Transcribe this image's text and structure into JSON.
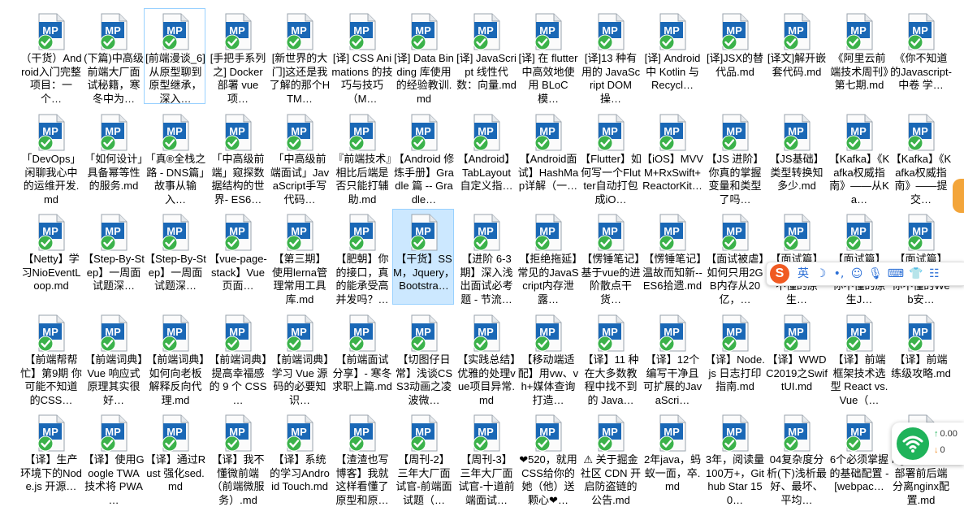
{
  "window": {
    "title": "Markdown files folder view"
  },
  "colors": {
    "icon_blue": "#1a68b6",
    "icon_check": "#3bb24a",
    "selection_fill": "#cce8ff",
    "selection_border": "#99d1ff",
    "ime_orange": "#f05a22",
    "wifi_green": "#1fb35a"
  },
  "file_icon": "markdown-mp-file-icon",
  "files": [
    {
      "name": "（干货）Android入门完整项目：一个…",
      "state": ""
    },
    {
      "name": "(下篇)中高级前端大厂面试秘籍，寒冬中为…",
      "state": ""
    },
    {
      "name": "[前端漫谈_6] 从原型聊到原型继承，深入…",
      "state": "outline"
    },
    {
      "name": "[手把手系列之] Docker 部署 vue 项…",
      "state": ""
    },
    {
      "name": "[新世界的大门]这还是我了解的那个HTM…",
      "state": ""
    },
    {
      "name": "[译] CSS Animations 的技巧与技巧（M…",
      "state": ""
    },
    {
      "name": "[译] Data Binding 库使用的经验教训.md",
      "state": ""
    },
    {
      "name": "[译] JavaScript 线性代数：向量.md",
      "state": ""
    },
    {
      "name": "[译] 在 flutter 中高效地使用 BLoC 模…",
      "state": ""
    },
    {
      "name": "[译]13 种有用的 JavaScript DOM 操…",
      "state": ""
    },
    {
      "name": "[译] Android 中 Kotlin 与 Recycl…",
      "state": ""
    },
    {
      "name": "[译]JSX的替代品.md",
      "state": ""
    },
    {
      "name": "[译文]解开嵌套代码.md",
      "state": ""
    },
    {
      "name": "《阿里云前端技术周刊》第七期.md",
      "state": ""
    },
    {
      "name": "《你不知道的Javascript-中卷 学…",
      "state": ""
    },
    {
      "name": "「DevOps」闲聊我心中的运维开发.md",
      "state": ""
    },
    {
      "name": "「如何设计」具备幂等性的服务.md",
      "state": ""
    },
    {
      "name": "「真®全栈之路 - DNS篇」故事从输入…",
      "state": ""
    },
    {
      "name": "「中高级前端」窥探数据结构的世界- ES6…",
      "state": ""
    },
    {
      "name": "「中高级前端面试」JavaScript手写代码…",
      "state": ""
    },
    {
      "name": "『前端技术』相比后端是否只能打辅助.md",
      "state": ""
    },
    {
      "name": "【Android 修炼手册】Gradle 篇 -- Gradle…",
      "state": ""
    },
    {
      "name": "【Android】TabLayout 自定义指…",
      "state": ""
    },
    {
      "name": "【Android面试】HashMap详解（一…",
      "state": ""
    },
    {
      "name": "【Flutter】如何写一个Flutter自动打包成iO…",
      "state": ""
    },
    {
      "name": "【iOS】MVVM+RxSwift+ReactorKit…",
      "state": ""
    },
    {
      "name": "【JS 进阶】你真的掌握变量和类型了吗…",
      "state": ""
    },
    {
      "name": "【JS基础】类型转换知多少.md",
      "state": ""
    },
    {
      "name": "【Kafka】《Kafka权威指南》——从Ka…",
      "state": ""
    },
    {
      "name": "【Kafka】《Kafka权威指南》——提交…",
      "state": ""
    },
    {
      "name": "【Netty】学习NioEventLoop.md",
      "state": ""
    },
    {
      "name": "【Step-By-Step】一周面试题深…",
      "state": ""
    },
    {
      "name": "【Step-By-Step】一周面试题深…",
      "state": ""
    },
    {
      "name": "【vue-page-stack】Vue页面…",
      "state": ""
    },
    {
      "name": "【第三期】使用lerna管理常用工具库.md",
      "state": ""
    },
    {
      "name": "【肥朝】你的接口，真的能承受高并发吗？…",
      "state": ""
    },
    {
      "name": "【干货】SSM，Jquery，Bootstra…",
      "state": "selected"
    },
    {
      "name": "【进阶 6-3 期】深入浅出面试必考题 - 节流…",
      "state": ""
    },
    {
      "name": "【拒绝拖延】常见的JavaScript内存泄露…",
      "state": ""
    },
    {
      "name": "【愣锤笔记】基于vue的进阶散点干货…",
      "state": ""
    },
    {
      "name": "【愣锤笔记】温故而知新--ES6拾遗.md",
      "state": ""
    },
    {
      "name": "【面试被虐】如何只用2GB内存从20亿，…",
      "state": ""
    },
    {
      "name": "【面试篇】全面攻坚你不懂的原生…",
      "state": ""
    },
    {
      "name": "【面试篇】寒冬求职之你不懂的原生J…",
      "state": ""
    },
    {
      "name": "【面试篇】寒冬求职之你不懂的Web安…",
      "state": ""
    },
    {
      "name": "【前端帮帮忙】第9期 你可能不知道的CSS…",
      "state": ""
    },
    {
      "name": "【前端词典】Vue 响应式原理其实很好…",
      "state": ""
    },
    {
      "name": "【前端词典】如何向老板解释反向代理.md",
      "state": ""
    },
    {
      "name": "【前端词典】提高幸福感的 9 个 CSS …",
      "state": ""
    },
    {
      "name": "【前端词典】学习 Vue 源码的必要知识…",
      "state": ""
    },
    {
      "name": "【前端面试分享】- 寒冬求职上篇.md",
      "state": ""
    },
    {
      "name": "【切图仔日常】浅谈CSS3动画之凌波微…",
      "state": ""
    },
    {
      "name": "【实践总结】优雅的处理vue项目异常.md",
      "state": ""
    },
    {
      "name": "【移动端适配】用vw、vh+媒体查询打造…",
      "state": ""
    },
    {
      "name": "【译】11 种在大多数教程中找不到的 Java…",
      "state": ""
    },
    {
      "name": "【译】12个编写干净且可扩展的JavaScri…",
      "state": ""
    },
    {
      "name": "【译】Node.js 日志打印指南.md",
      "state": ""
    },
    {
      "name": "【译】WWDC2019之SwiftUI.md",
      "state": ""
    },
    {
      "name": "【译】前端框架技术选型 React vs. Vue（…",
      "state": ""
    },
    {
      "name": "【译】前端练级攻略.md",
      "state": ""
    },
    {
      "name": "【译】生产环境下的Node.js 开源…",
      "state": ""
    },
    {
      "name": "【译】使用Google TWA 技术将 PWA …",
      "state": ""
    },
    {
      "name": "【译】通过Rust 强化sed.md",
      "state": ""
    },
    {
      "name": "【译】我不懂微前端（前端微服务）.md",
      "state": ""
    },
    {
      "name": "【译】系统的学习Android Touch.md",
      "state": ""
    },
    {
      "name": "【渣渣也写博客】我就这样看懂了原型和原…",
      "state": ""
    },
    {
      "name": "【周刊-2】三年大厂面试官-前端面试题（…",
      "state": ""
    },
    {
      "name": "【周刊-3】三年大厂面试官-十道前端面试…",
      "state": ""
    },
    {
      "name": "❤520，就用CSS给你的她（他）送颗心❤…",
      "state": ""
    },
    {
      "name": "⚠ 关于掘金社区 CDN 开启防盗链的公告.md",
      "state": ""
    },
    {
      "name": "2年java，蚂蚁一面，卒.md",
      "state": ""
    },
    {
      "name": "3年，阅读量100万+，Github Star 150…",
      "state": ""
    },
    {
      "name": "04复杂度分析(下)浅析最好、最坏、平均…",
      "state": ""
    },
    {
      "name": "6个必须掌握的基础配置 - [webpac…",
      "state": ""
    },
    {
      "name": "Nginx服务器部署前后端分离nginx配置.md",
      "state": ""
    }
  ],
  "ime_toolbar": {
    "logo": "S",
    "buttons": [
      {
        "label": "英",
        "icon": "lang-toggle-icon"
      },
      {
        "label": "☽",
        "icon": "moon-icon"
      },
      {
        "label": "•,",
        "icon": "punctuation-icon"
      },
      {
        "label": "☺",
        "icon": "emoji-icon"
      },
      {
        "label": "🎙",
        "icon": "microphone-icon"
      },
      {
        "label": "⌨",
        "icon": "keyboard-icon"
      },
      {
        "label": "👕",
        "icon": "skin-icon"
      },
      {
        "label": "☷",
        "icon": "menu-grid-icon"
      }
    ]
  },
  "side_tab": {
    "label": ""
  },
  "net_widget": {
    "up": "0.00",
    "down": "0"
  }
}
